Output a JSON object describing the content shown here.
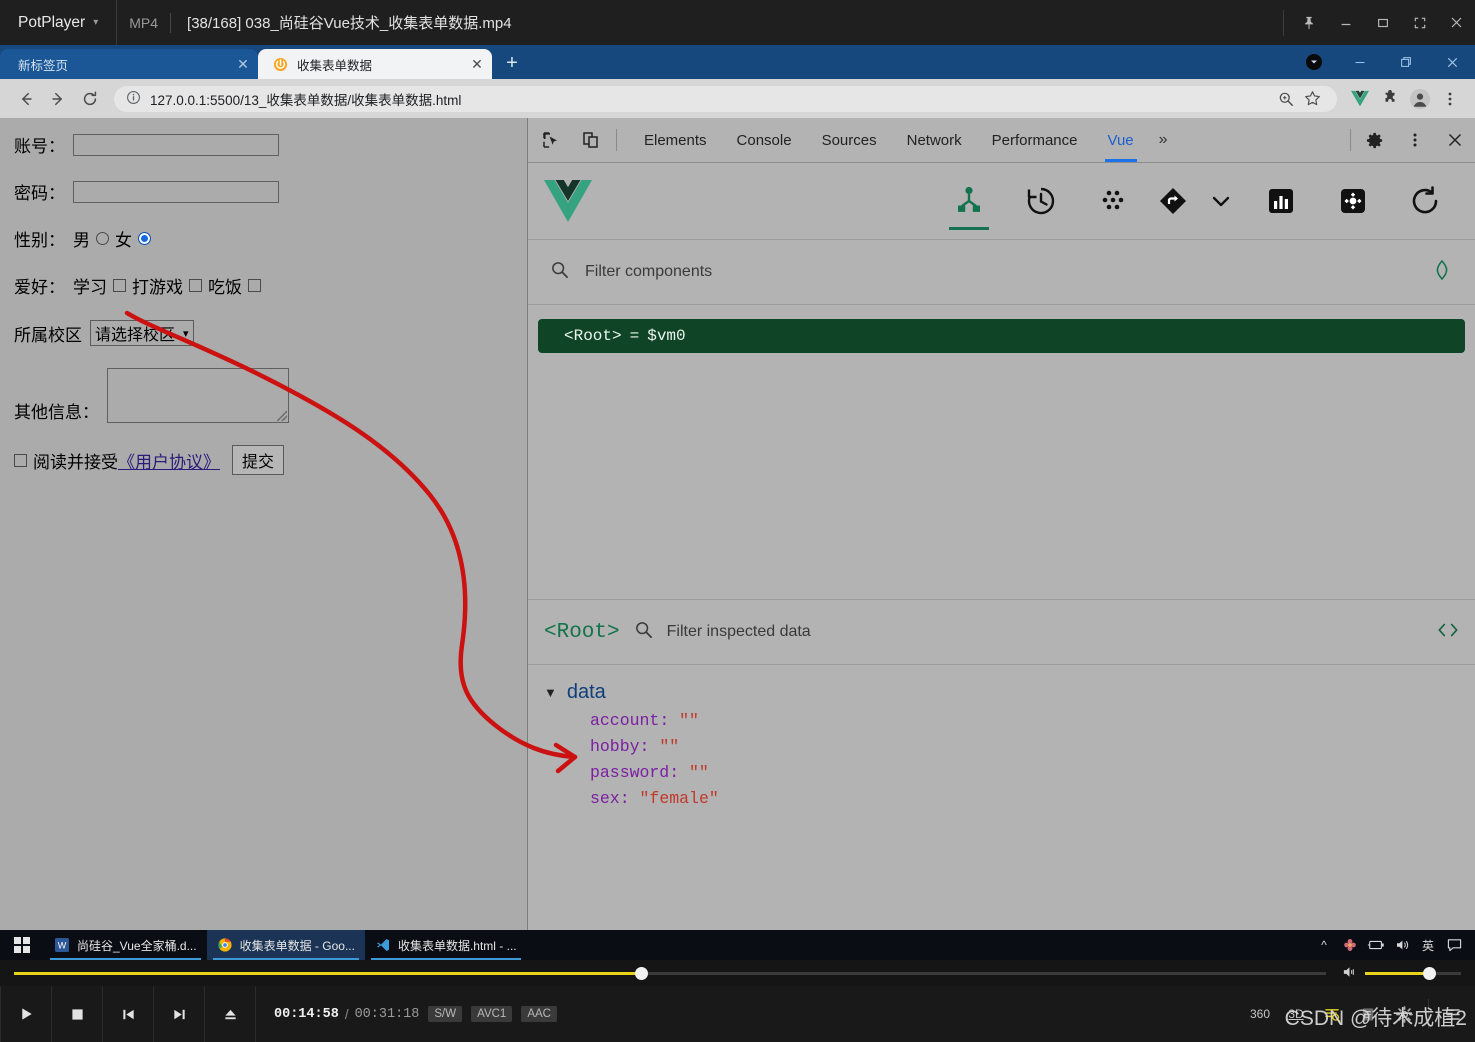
{
  "potplayer": {
    "app_name": "PotPlayer",
    "format": "MP4",
    "title": "[38/168] 038_尚硅谷Vue技术_收集表单数据.mp4",
    "window_buttons": [
      "pin-icon",
      "minimize-icon",
      "maximize-icon",
      "fullscreen-icon",
      "close-icon"
    ],
    "seek": {
      "percent": 47.8
    },
    "volume": {
      "percent": 67
    },
    "controls": {
      "play": "play-icon",
      "stop": "stop-icon",
      "previous": "previous-icon",
      "next": "next-icon",
      "eject": "eject-icon",
      "current_time": "00:14:58",
      "separator": "/",
      "total_time": "00:31:18",
      "badges": [
        "S/W",
        "AVC1",
        "AAC"
      ],
      "right_icons": [
        "360-icon",
        "3D-icon",
        "playlist-icon",
        "subtitle-icon",
        "settings-icon",
        "menu-icon"
      ],
      "label_360": "360",
      "label_3d": "3D"
    },
    "watermark": "CSDN @待木成植2"
  },
  "chrome": {
    "tabs": [
      {
        "label": "新标签页",
        "active": false,
        "favicon": "none"
      },
      {
        "label": "收集表单数据",
        "active": true,
        "favicon": "live-server-icon"
      }
    ],
    "new_tab_label": "+",
    "window_controls": [
      "account-icon",
      "minimize-icon",
      "restore-icon",
      "close-icon"
    ],
    "nav": {
      "back": "back-arrow-icon",
      "forward": "forward-arrow-icon",
      "reload": "reload-icon"
    },
    "omnibox": {
      "info_icon": "info-circle-icon",
      "url": "127.0.0.1:5500/13_收集表单数据/收集表单数据.html",
      "zoom_icon": "zoom-magnifier-icon",
      "bookmark_icon": "star-icon"
    },
    "extensions": [
      "vue-devtools-icon",
      "puzzle-extensions-icon",
      "profile-avatar-icon",
      "kebab-menu-icon"
    ]
  },
  "form": {
    "account": {
      "label": "账号：",
      "value": "",
      "placeholder": ""
    },
    "password": {
      "label": "密码：",
      "value": "",
      "placeholder": ""
    },
    "sex": {
      "label": "性别：",
      "options": [
        {
          "label": "男",
          "checked": false
        },
        {
          "label": "女",
          "checked": true
        }
      ]
    },
    "hobby": {
      "label": "爱好：",
      "options": [
        {
          "label": "学习",
          "checked": false
        },
        {
          "label": "打游戏",
          "checked": false
        },
        {
          "label": "吃饭",
          "checked": false
        }
      ]
    },
    "campus": {
      "label": "所属校区",
      "selected": "请选择校区"
    },
    "other": {
      "label": "其他信息：",
      "value": ""
    },
    "agree": {
      "prefix": "阅读并接受",
      "link": "《用户协议》",
      "checked": false
    },
    "submit_label": "提交"
  },
  "devtools": {
    "left_icons": [
      "inspect-element-icon",
      "device-toolbar-icon"
    ],
    "tabs": [
      {
        "label": "Elements",
        "selected": false
      },
      {
        "label": "Console",
        "selected": false
      },
      {
        "label": "Sources",
        "selected": false
      },
      {
        "label": "Network",
        "selected": false
      },
      {
        "label": "Performance",
        "selected": false
      },
      {
        "label": "Vue",
        "selected": true
      }
    ],
    "more_tabs": "»",
    "right_icons": [
      "settings-gear-icon",
      "kebab-menu-icon",
      "close-icon"
    ],
    "vue": {
      "logo": "vue-logo-icon",
      "toolbar_icons": [
        {
          "name": "component-tree-icon",
          "selected": true
        },
        {
          "name": "timeline-history-icon",
          "selected": false
        },
        {
          "name": "vuex-dots-icon",
          "selected": false
        },
        {
          "name": "routes-diamond-icon",
          "selected": false
        },
        {
          "name": "performance-bars-icon",
          "selected": false
        },
        {
          "name": "settings-gear-icon",
          "selected": false
        },
        {
          "name": "refresh-icon",
          "selected": false
        }
      ],
      "filter_placeholder": "Filter components",
      "target_icon": "select-component-target-icon",
      "tree": [
        {
          "tag": "<Root>",
          "equals": "=",
          "instance": "$vm0",
          "selected": true
        }
      ],
      "inspector": {
        "component": "<Root>",
        "filter_placeholder": "Filter inspected data",
        "code_icon": "open-in-editor-icon",
        "group": "data",
        "props": [
          {
            "key": "account",
            "value": "\"\""
          },
          {
            "key": "hobby",
            "value": "\"\""
          },
          {
            "key": "password",
            "value": "\"\""
          },
          {
            "key": "sex",
            "value": "\"female\""
          }
        ]
      }
    }
  },
  "taskbar": {
    "start": "windows-start-icon",
    "items": [
      {
        "label": "尚硅谷_Vue全家桶.d...",
        "icon": "word-icon",
        "active": false
      },
      {
        "label": "收集表单数据 - Goo...",
        "icon": "chrome-icon",
        "active": true
      },
      {
        "label": "收集表单数据.html - ...",
        "icon": "vscode-icon",
        "active": false
      }
    ],
    "tray": [
      "chevron-up-icon",
      "flower-icon",
      "battery-icon",
      "volume-icon",
      "ime-icon",
      "notifications-icon"
    ],
    "ime_label": "英"
  },
  "annotation": {
    "color": "#cc1111",
    "description": "red-arrow-from-hobby-checkbox-to-hobby-data-property"
  }
}
